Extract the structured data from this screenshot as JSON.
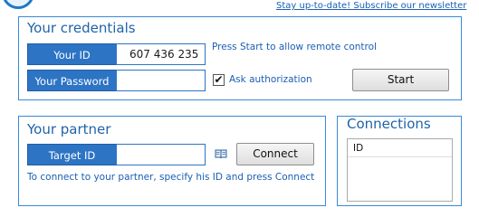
{
  "header": {
    "newsletter_link": "Stay up-to-date! Subscribe our newsletter"
  },
  "credentials": {
    "title": "Your credentials",
    "id_label": "Your ID",
    "id_value": "607 436 235",
    "password_label": "Your Password",
    "password_value": "",
    "start_hint": "Press Start to allow remote control",
    "ask_authorization_label": "Ask authorization",
    "ask_authorization_checked": "✔",
    "start_button": "Start"
  },
  "partner": {
    "title": "Your partner",
    "target_label": "Target ID",
    "target_value": "",
    "address_book_icon": "address-book-icon",
    "connect_button": "Connect",
    "hint": "To connect to your partner, specify his ID and press Connect"
  },
  "connections": {
    "title": "Connections",
    "column_header": "ID"
  },
  "colors": {
    "accent": "#2d74c4",
    "panel_border": "#3a8ad8",
    "title_text": "#1f63a8",
    "link": "#1a5fb4"
  }
}
